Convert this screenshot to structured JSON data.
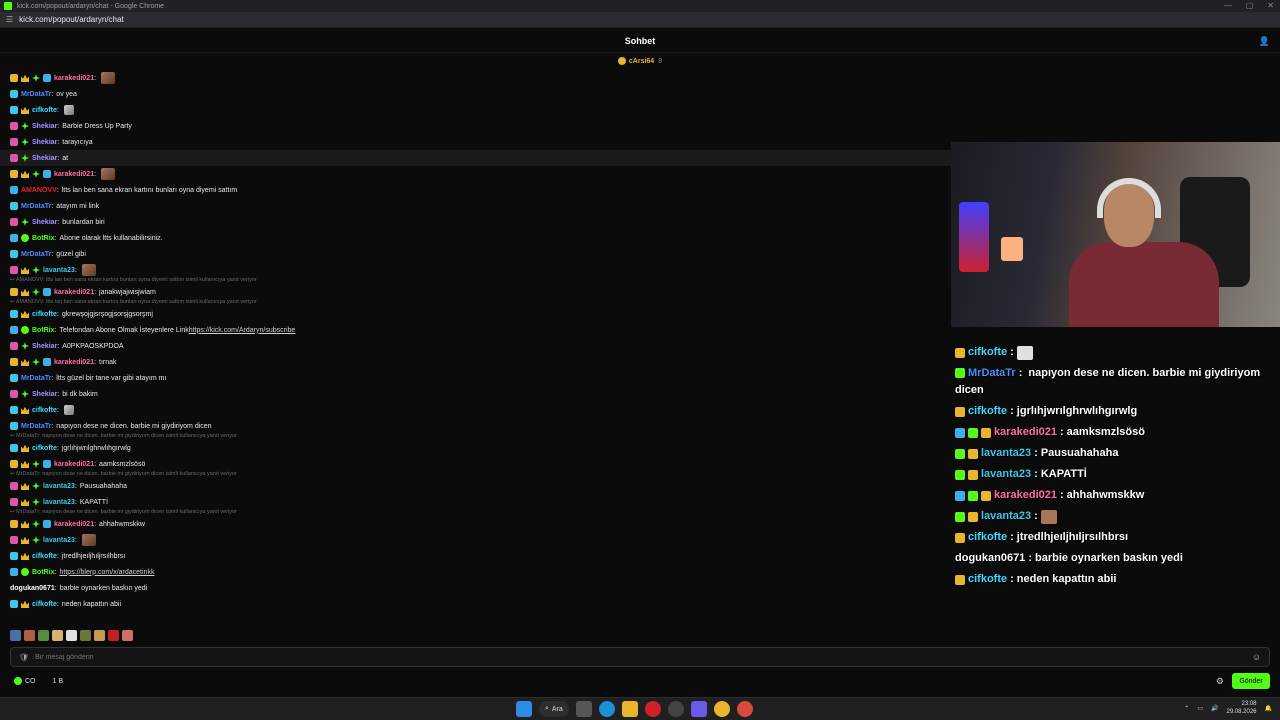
{
  "window": {
    "title": "kick.com/popout/ardaryn/chat - Google Chrome",
    "url": "kick.com/popout/ardaryn/chat"
  },
  "chat": {
    "title": "Sohbet",
    "pinned_user": "cArsi64",
    "pinned_count": "8"
  },
  "messages": [
    {
      "type": "msg",
      "badges": [
        "b-sub",
        "b-crown",
        "b-og",
        "b-bot"
      ],
      "user": "karakedi021",
      "color": "#ff6fa0",
      "text": "",
      "emote": true
    },
    {
      "type": "msg",
      "badges": [
        "b-mod"
      ],
      "user": "MrDataTr",
      "color": "#4d8cff",
      "text": "ov yea"
    },
    {
      "type": "msg",
      "badges": [
        "b-mod",
        "b-crown"
      ],
      "user": "cifkofte",
      "color": "#3fdcff",
      "text": "",
      "emote": "sm"
    },
    {
      "type": "msg",
      "badges": [
        "b-vip",
        "b-og"
      ],
      "user": "Shekiar",
      "color": "#a892ff",
      "text": "Barbie Dress Up Party"
    },
    {
      "type": "msg",
      "badges": [
        "b-vip",
        "b-og"
      ],
      "user": "Shekiar",
      "color": "#a892ff",
      "text": "tarayıcıya"
    },
    {
      "type": "msg",
      "badges": [
        "b-vip",
        "b-og"
      ],
      "user": "Shekiar",
      "color": "#a892ff",
      "text": "at",
      "hl": true
    },
    {
      "type": "msg",
      "badges": [
        "b-sub",
        "b-crown",
        "b-og",
        "b-bot"
      ],
      "user": "karakedi021",
      "color": "#ff6fa0",
      "text": "",
      "emote": true
    },
    {
      "type": "msg",
      "badges": [
        "b-bot"
      ],
      "user": "AMANOVV",
      "color": "#e8232f",
      "text": "ltts lan ben sana ekran kartını bunları oyna diyemi sattım"
    },
    {
      "type": "msg",
      "badges": [
        "b-mod"
      ],
      "user": "MrDataTr",
      "color": "#4d8cff",
      "text": "atayım mi link"
    },
    {
      "type": "msg",
      "badges": [
        "b-vip",
        "b-og"
      ],
      "user": "Shekiar",
      "color": "#a892ff",
      "text": "bunlardan biri"
    },
    {
      "type": "msg",
      "badges": [
        "b-bot",
        "b-ver"
      ],
      "user": "BotRix",
      "color": "#53fc18",
      "text": "Abone olarak ltts kullanabilirsiniz."
    },
    {
      "type": "msg",
      "badges": [
        "b-mod"
      ],
      "user": "MrDataTr",
      "color": "#4d8cff",
      "text": "güzel gibi"
    },
    {
      "type": "msg",
      "badges": [
        "b-vip",
        "b-crown",
        "b-og"
      ],
      "user": "lavanta23",
      "color": "#3ec7e8",
      "text": "",
      "emote": true
    },
    {
      "type": "reply",
      "text": "↩ AMANOVV: ltts lan ben sana ekran kartını bunları oyna diyemi sattım isimli kullanıcıya yanıt veriyor"
    },
    {
      "type": "msg",
      "badges": [
        "b-sub",
        "b-crown",
        "b-og",
        "b-bot"
      ],
      "user": "karakedi021",
      "color": "#ff6fa0",
      "text": "janakwjajwisjwiam"
    },
    {
      "type": "reply",
      "text": "↩ AMANOVV: ltts lan ben sana ekran kartını bunları oyna diyemi sattım isimli kullanıcıya yanıt veriyor"
    },
    {
      "type": "msg",
      "badges": [
        "b-mod",
        "b-crown"
      ],
      "user": "cifkofte",
      "color": "#3fdcff",
      "text": "gkrewşojgjsrşogjsorşjgsorşmj"
    },
    {
      "type": "msg",
      "badges": [
        "b-bot",
        "b-ver"
      ],
      "user": "BotRix",
      "color": "#53fc18",
      "text": "Telefondan Abone Olmak İsteyenlere Link ",
      "link": "https://kick.com/Ardaryn/subscribe"
    },
    {
      "type": "msg",
      "badges": [
        "b-vip",
        "b-og"
      ],
      "user": "Shekiar",
      "color": "#a892ff",
      "text": "A0PKPAOSKPDOA"
    },
    {
      "type": "msg",
      "badges": [
        "b-sub",
        "b-crown",
        "b-og",
        "b-bot"
      ],
      "user": "karakedi021",
      "color": "#ff6fa0",
      "text": "tırnak"
    },
    {
      "type": "msg",
      "badges": [
        "b-mod"
      ],
      "user": "MrDataTr",
      "color": "#4d8cff",
      "text": "ltts güzel bir tane var gibi atayım mı"
    },
    {
      "type": "msg",
      "badges": [
        "b-vip",
        "b-og"
      ],
      "user": "Shekiar",
      "color": "#a892ff",
      "text": "bi dk bakim"
    },
    {
      "type": "msg",
      "badges": [
        "b-mod",
        "b-crown"
      ],
      "user": "cifkofte",
      "color": "#3fdcff",
      "text": "",
      "emote": "sm"
    },
    {
      "type": "msg",
      "badges": [
        "b-mod"
      ],
      "user": "MrDataTr",
      "color": "#4d8cff",
      "text": "napıyon dese ne dicen. barbie mi giydiriyom dicen"
    },
    {
      "type": "reply",
      "text": "↩ MrDataTr: napıyon dese ne dicen. barbie mi giydiriyom dicen isimli kullanıcıya yanıt veriyor"
    },
    {
      "type": "msg",
      "badges": [
        "b-mod",
        "b-crown"
      ],
      "user": "cifkofte",
      "color": "#3fdcff",
      "text": "jgrlıhjwrılghrwlıhgırwlg"
    },
    {
      "type": "msg",
      "badges": [
        "b-sub",
        "b-crown",
        "b-og",
        "b-bot"
      ],
      "user": "karakedi021",
      "color": "#ff6fa0",
      "text": "aamksmzlsösö"
    },
    {
      "type": "reply",
      "text": "↩ MrDataTr: napıyon dese ne dicen. barbie mi giydiriyom dicen isimli kullanıcıya yanıt veriyor"
    },
    {
      "type": "msg",
      "badges": [
        "b-vip",
        "b-crown",
        "b-og"
      ],
      "user": "lavanta23",
      "color": "#3ec7e8",
      "text": "Pausuahahaha"
    },
    {
      "type": "msg",
      "badges": [
        "b-vip",
        "b-crown",
        "b-og"
      ],
      "user": "lavanta23",
      "color": "#3ec7e8",
      "text": "KAPATTİ"
    },
    {
      "type": "reply",
      "text": "↩ MrDataTr: napıyon dese ne dicen. barbie mi giydiriyom dicen isimli kullanıcıya yanıt veriyor"
    },
    {
      "type": "msg",
      "badges": [
        "b-sub",
        "b-crown",
        "b-og",
        "b-bot"
      ],
      "user": "karakedi021",
      "color": "#ff6fa0",
      "text": "ahhahwmskkw"
    },
    {
      "type": "msg",
      "badges": [
        "b-vip",
        "b-crown",
        "b-og"
      ],
      "user": "lavanta23",
      "color": "#3ec7e8",
      "text": "",
      "emote": true
    },
    {
      "type": "msg",
      "badges": [
        "b-mod",
        "b-crown"
      ],
      "user": "cifkofte",
      "color": "#3fdcff",
      "text": "jtredlhjeıljhıljrsılhbrsı"
    },
    {
      "type": "msg",
      "badges": [
        "b-bot",
        "b-ver"
      ],
      "user": "BotRix",
      "color": "#53fc18",
      "text": "",
      "link": "https://blerp.com/x/ardacetinkk"
    },
    {
      "type": "msg",
      "badges": [],
      "user": "dogukan0671",
      "color": "#ffffff",
      "text": "barbie oynarken baskın yedi"
    },
    {
      "type": "msg",
      "badges": [
        "b-mod",
        "b-crown"
      ],
      "user": "cifkofte",
      "color": "#3fdcff",
      "text": "neden kapattın abii"
    }
  ],
  "emote_bar": [
    "#4a6fa5",
    "#b06040",
    "#5a8a3a",
    "#d8b070",
    "#e0e0e0",
    "#6a7a3a",
    "#c89a50",
    "#c02020",
    "#d07060"
  ],
  "input": {
    "placeholder": "Bir mesaj gönderin"
  },
  "footer": {
    "points_label": "CO",
    "points2": "1 B",
    "send_label": "Gönder"
  },
  "taskbar": {
    "search_label": "Ara",
    "time": "23:08",
    "date": "29.08.2026"
  },
  "overlay": [
    {
      "user": "cifkofte",
      "color": "#3fdcff",
      "badges": [
        "#e8b52d"
      ],
      "text": "",
      "emote": "#e0e0e0"
    },
    {
      "user": "MrDataTr",
      "color": "#4d8cff",
      "badges": [
        "#53fc18"
      ],
      "text": "napıyon dese ne dicen. barbie mi giydiriyom dicen",
      "wrap": true
    },
    {
      "user": "cifkofte",
      "color": "#3fdcff",
      "badges": [
        "#e8b52d"
      ],
      "text": "jgrlıhjwrılghrwlıhgırwlg"
    },
    {
      "user": "karakedi021",
      "color": "#ff6fa0",
      "badges": [
        "#3db0e8",
        "#53fc18",
        "#e8b52d"
      ],
      "text": "aamksmzlsösö"
    },
    {
      "user": "lavanta23",
      "color": "#3ec7e8",
      "badges": [
        "#53fc18",
        "#e8b52d"
      ],
      "text": "Pausuahahaha"
    },
    {
      "user": "lavanta23",
      "color": "#3ec7e8",
      "badges": [
        "#53fc18",
        "#e8b52d"
      ],
      "text": "KAPATTİ"
    },
    {
      "user": "karakedi021",
      "color": "#ff6fa0",
      "badges": [
        "#3db0e8",
        "#53fc18",
        "#e8b52d"
      ],
      "text": "ahhahwmskkw"
    },
    {
      "user": "lavanta23",
      "color": "#3ec7e8",
      "badges": [
        "#53fc18",
        "#e8b52d"
      ],
      "text": "",
      "emote": "#a8745a"
    },
    {
      "user": "cifkofte",
      "color": "#3fdcff",
      "badges": [
        "#e8b52d"
      ],
      "text": "jtredlhjeıljhıljrsılhbrsı"
    },
    {
      "user": "dogukan0671",
      "color": "#ffffff",
      "badges": [],
      "text": "barbie oynarken baskın yedi"
    },
    {
      "user": "cifkofte",
      "color": "#3fdcff",
      "badges": [
        "#e8b52d"
      ],
      "text": "neden kapattın abii"
    }
  ]
}
